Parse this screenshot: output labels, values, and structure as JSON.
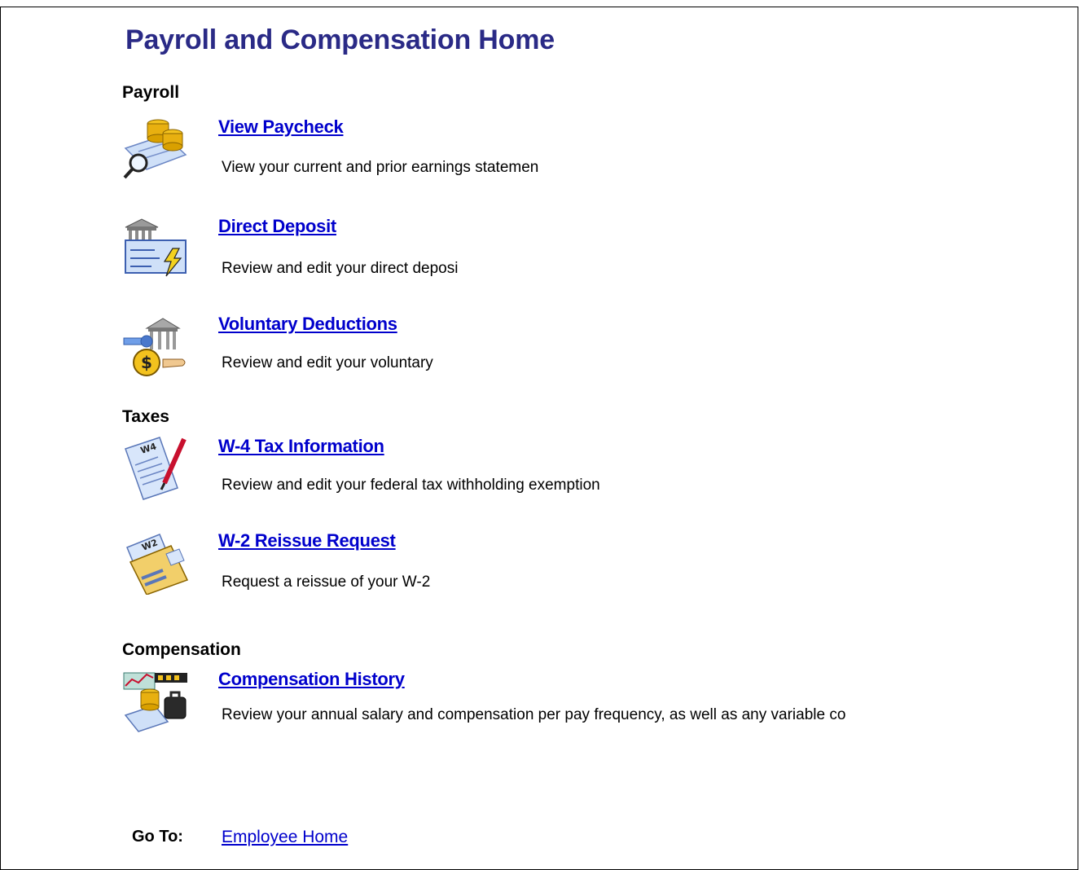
{
  "page_title": "Payroll and Compensation Home",
  "sections": {
    "payroll": "Payroll",
    "taxes": "Taxes",
    "compensation": "Compensation"
  },
  "items": {
    "view_paycheck": {
      "link": "View Paycheck",
      "description": "View your current and prior earnings statemen",
      "icon": "paycheck-icon"
    },
    "direct_deposit": {
      "link": "Direct Deposit",
      "description": "Review and edit your direct deposi",
      "icon": "bank-check-icon"
    },
    "voluntary_deductions": {
      "link": "Voluntary Deductions",
      "description": "Review and edit your voluntary",
      "icon": "deductions-icon"
    },
    "w4": {
      "link": "W-4 Tax Information",
      "description": "Review and edit your federal tax withholding exemption",
      "icon": "w4-form-icon",
      "badge": "W4"
    },
    "w2": {
      "link": "W-2 Reissue Request",
      "description": "Request a reissue of your W-2",
      "icon": "w2-envelope-icon",
      "badge": "W2"
    },
    "compensation_history": {
      "link": "Compensation History",
      "description": "Review your annual salary and compensation per pay frequency, as well as any variable co",
      "icon": "compensation-icon"
    }
  },
  "footer": {
    "goto_label": "Go To:",
    "goto_link": "Employee Home"
  },
  "colors": {
    "title": "#2a2a86",
    "link": "#0000cc"
  }
}
